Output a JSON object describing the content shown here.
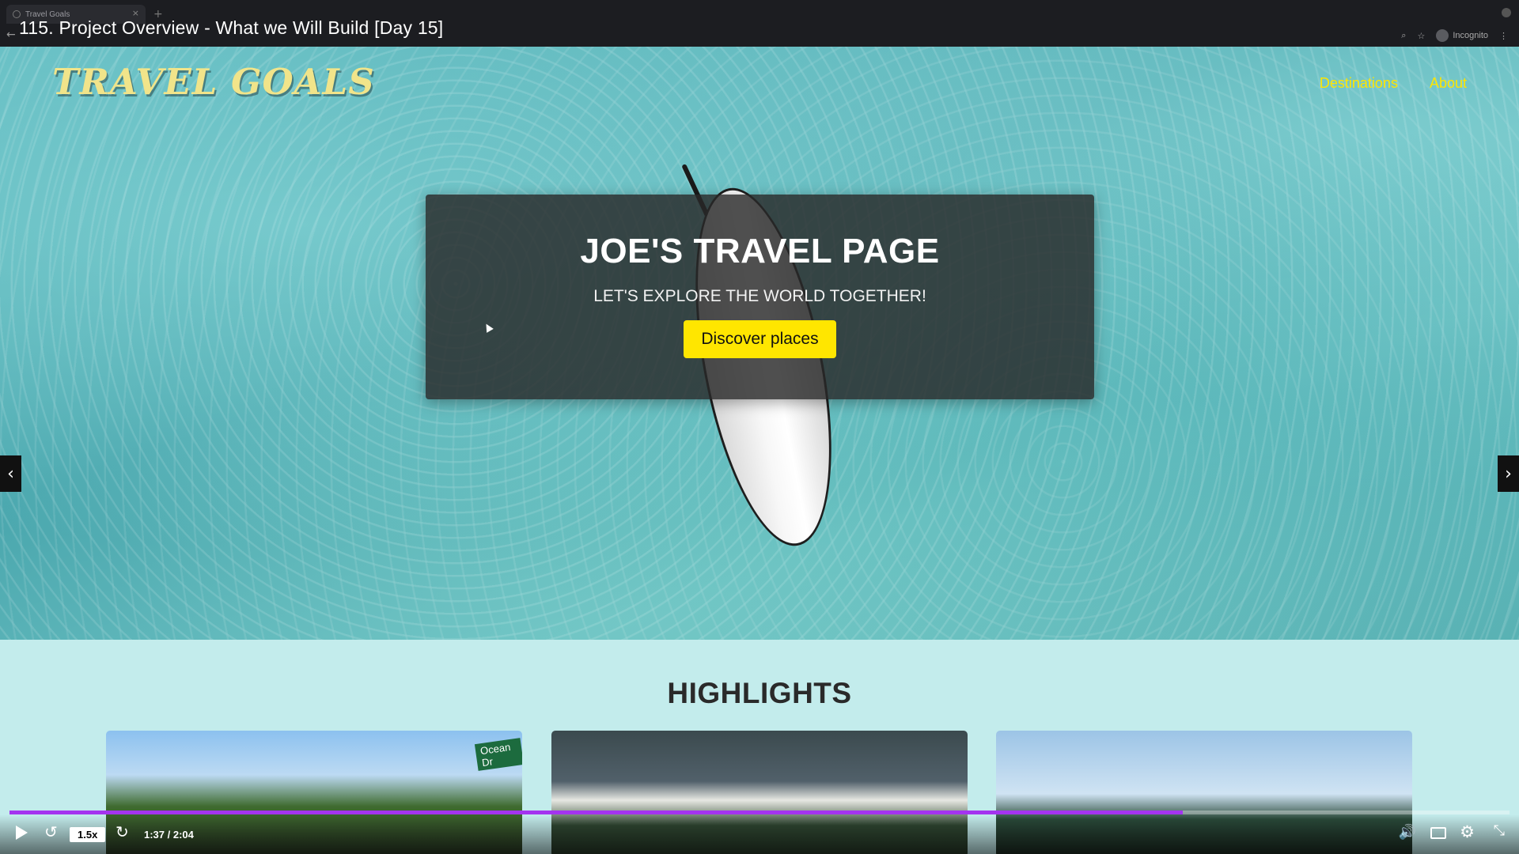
{
  "browser": {
    "tab_title": "Travel Goals",
    "tab_close": "×",
    "new_tab": "+",
    "incognito_label": "Incognito",
    "zoom_icon": "⌕",
    "star_icon": "☆",
    "menu_icon": "⋮",
    "back_icon": "←"
  },
  "video": {
    "title": "115. Project Overview - What we Will Build [Day 15]",
    "speed": "1.5x",
    "time": "1:37 / 2:04",
    "progress": 0.782,
    "accent_color": "#a434ef",
    "rewind_icon": "↺",
    "forward_icon": "↻",
    "volume_icon": "🔊",
    "settings_icon": "⚙",
    "fullscreen_icon": "⤡"
  },
  "site": {
    "logo": "TRAVEL GOALS",
    "nav": [
      "Destinations",
      "About"
    ],
    "nav_color": "#ffe600",
    "hero": {
      "title": "JOE'S TRAVEL PAGE",
      "subtitle": "LET'S EXPLORE THE WORLD TOGETHER!",
      "cta": "Discover places"
    },
    "slider": {
      "prev_icon": "‹",
      "next_icon": "›"
    },
    "highlights": {
      "title": "HIGHLIGHTS",
      "street_sign": "Ocean Dr"
    }
  }
}
